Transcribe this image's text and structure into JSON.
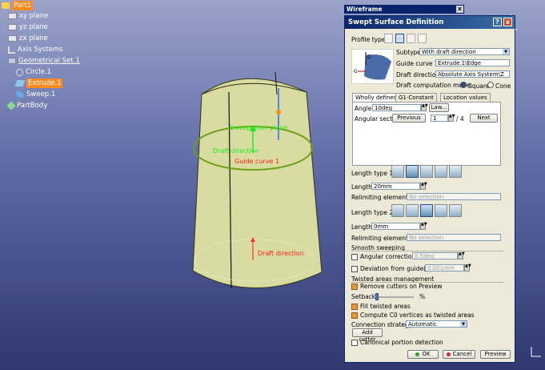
{
  "tree": [
    {
      "label": "Part1",
      "icon": "part-icon",
      "selected": true,
      "underline": false
    },
    {
      "label": "xy plane",
      "icon": "plane-icon",
      "selected": false,
      "underline": false
    },
    {
      "label": "yz plane",
      "icon": "plane-icon",
      "selected": false,
      "underline": false
    },
    {
      "label": "zx plane",
      "icon": "plane-icon",
      "selected": false,
      "underline": false
    },
    {
      "label": "Axis Systems",
      "icon": "axis-systems-icon",
      "selected": false,
      "underline": false
    },
    {
      "label": "Geometrical Set.1",
      "icon": "geometrical-set-icon",
      "selected": false,
      "underline": true
    },
    {
      "label": "Circle.1",
      "icon": "circle-icon",
      "selected": false,
      "underline": false
    },
    {
      "label": "Extrude.1",
      "icon": "extrude-icon",
      "selected": true,
      "underline": false
    },
    {
      "label": "Sweep.1",
      "icon": "sweep-icon",
      "selected": false,
      "underline": false
    },
    {
      "label": "PartBody",
      "icon": "partbody-icon",
      "selected": false,
      "underline": false
    }
  ],
  "viewport": {
    "labels": {
      "sweep_start_plane": "Sweep start plane",
      "draft_direction_top": "Draft direction",
      "guide_curve": "Guide curve 1",
      "draft_direction_bottom": "Draft direction"
    },
    "colors": {
      "surface": "#d9dca0",
      "guide": "#6ea018",
      "label_green": "#22ee22",
      "label_red": "#ff2020"
    }
  },
  "wireframe_toolbar": {
    "title": "Wireframe",
    "close": "x"
  },
  "dialog": {
    "title": "Swept Surface Definition",
    "help_glyph": "?",
    "close_glyph": "x",
    "profile_type_label": "Profile type:",
    "subtype_label": "Subtype:",
    "subtype_value": "With draft direction",
    "guide_curve_label": "Guide curve 1:",
    "guide_curve_value": "Extrude.1\\Edge",
    "draft_direction_label": "Draft direction:",
    "draft_direction_value": "Absolute Axis System\\Z",
    "draft_mode_label": "Draft computation mode:",
    "mode_square": "Square",
    "mode_cone": "Cone",
    "preview_labels": {
      "d": "D",
      "g": "G"
    },
    "tabs": [
      "Wholly defined",
      "G1-Constant",
      "Location values"
    ],
    "angle_label": "Angle:",
    "angle_value": "10deg",
    "law_button": "Law...",
    "angular_sector_label": "Angular sector:",
    "previous_button": "Previous",
    "sector_value": "1",
    "sector_total": "/ 4",
    "next_button": "Next",
    "length_type1_label": "Length type 1:",
    "length1_label": "Length 1:",
    "length1_value": "20mm",
    "relimiting1_label": "Relimiting element 1:",
    "relimiting1_value": "No selection",
    "length_type2_label": "Length type 2:",
    "length2_label": "Length 2:",
    "length2_value": "0mm",
    "relimiting2_label": "Relimiting element 2:",
    "relimiting2_value": "No selection",
    "smooth_sweeping_label": "Smooth sweeping",
    "angular_correction_label": "Angular correction:",
    "angular_correction_value": "0.5deg",
    "deviation_label": "Deviation from guide(s):",
    "deviation_value": "0.001mm",
    "twisted_label": "Twisted areas management",
    "remove_cutters_label": "Remove cutters on Preview",
    "setback_label": "Setback",
    "setback_unit": "%",
    "setback_fraction": 0.05,
    "fill_twisted_label": "Fill twisted areas",
    "compute_c0_label": "Compute C0 vertices as twisted areas",
    "connection_label": "Connection strategy:",
    "connection_value": "Automatic",
    "add_cutter_button": "Add cutter",
    "canonical_label": "Canonical portion detection",
    "ok_button": "OK",
    "cancel_button": "Cancel",
    "preview_button": "Preview"
  }
}
